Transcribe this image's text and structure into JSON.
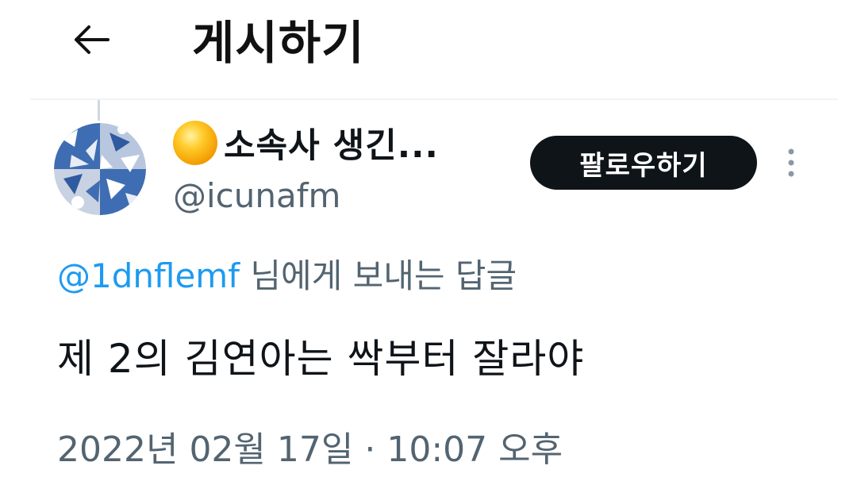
{
  "header": {
    "back_icon": "arrow-left-icon",
    "title": "게시하기"
  },
  "tweet": {
    "author": {
      "emoji_icon": "sun-emoji-icon",
      "display_name": "소속사 생긴...",
      "handle": "@icunafm"
    },
    "follow_label": "팔로우하기",
    "more_icon": "more-vertical-icon",
    "reply_to": {
      "mention": "@1dnflemf",
      "suffix": " 님에게 보내는 답글"
    },
    "text": "제 2의 김연아는 싹부터 잘라야",
    "timestamp": "2022년 02월 17일 · 10:07 오후"
  },
  "colors": {
    "accent": "#1d9bf0",
    "secondary_text": "#536471",
    "primary_text": "#0f1419",
    "follow_button_bg": "#0f1419"
  }
}
